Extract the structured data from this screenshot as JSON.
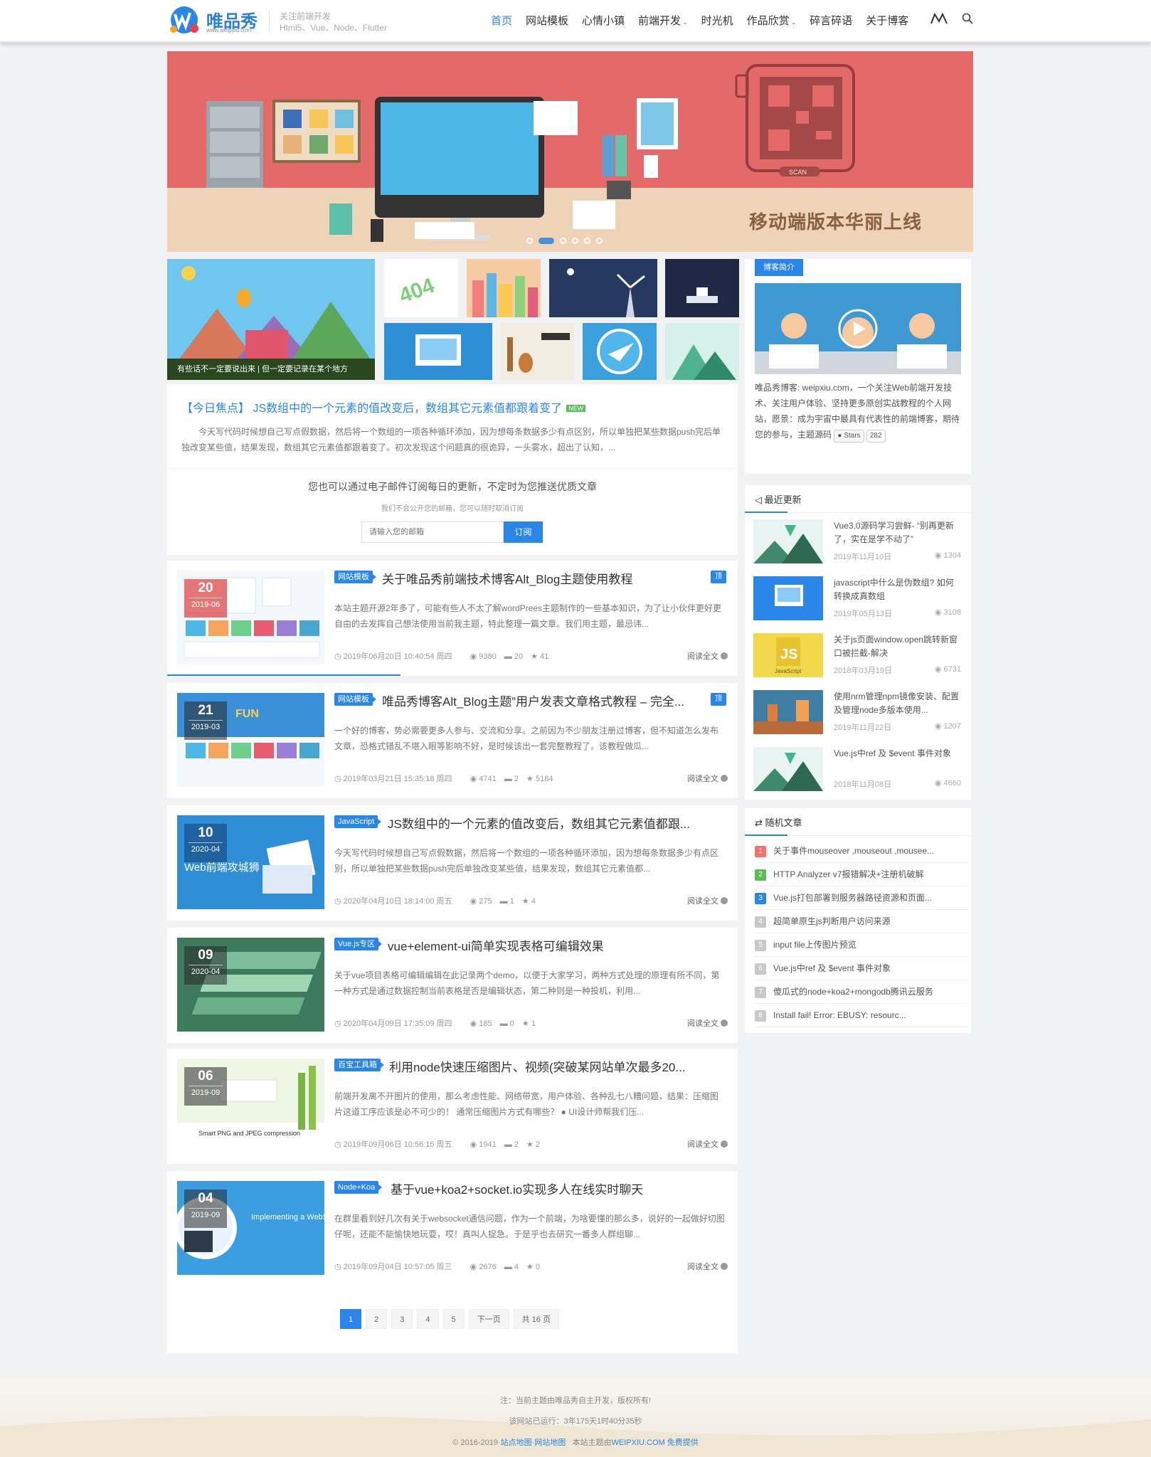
{
  "header": {
    "brand": "唯品秀",
    "domain": "www.weipxiu.com",
    "tagline1": "关注前端开发",
    "tagline2": "Html5、Vue、Node、Flutter",
    "nav": [
      {
        "label": "首页",
        "active": true
      },
      {
        "label": "网站模板"
      },
      {
        "label": "心情小镇"
      },
      {
        "label": "前端开发",
        "dropdown": true
      },
      {
        "label": "时光机"
      },
      {
        "label": "作品欣赏",
        "dropdown": true
      },
      {
        "label": "碎言碎语"
      },
      {
        "label": "关于博客"
      }
    ],
    "icons": [
      "logo-mark-icon",
      "search-icon"
    ]
  },
  "banner": {
    "text": "移动端版本华丽上线",
    "qr_label": "SCAN",
    "bg_color": "#e46a69",
    "slides": 6,
    "active_slide": 2
  },
  "gallery": {
    "caption": "有些话不一定要说出来 | 但一定要记录在某个地方"
  },
  "focus": {
    "title": "【今日焦点】 JS数组中的一个元素的值改变后，数组其它元素值都跟着变了",
    "new_badge": "NEW",
    "excerpt": "今天写代码时候想自己写点假数据，然后将一个数组的一项各种循环添加，因为想每条数据多少有点区别，所以单独把某些数据push完后单独改变某些值，结果发现，数组其它元素值都跟着变了。初次发现这个问题真的很诡异，一头雾水，超出了认知，..."
  },
  "subscribe": {
    "title": "您也可以通过电子邮件订阅每日的更新，不定时为您推送优质文章",
    "sub": "我们不会公开您的邮箱，您可以随时取消订阅",
    "placeholder": "请输入您的邮箱",
    "button": "订阅"
  },
  "posts": [
    {
      "day": "20",
      "month": "2019-06",
      "category": "网站模板",
      "title": "关于唯品秀前端技术博客Alt_Blog主题使用教程",
      "top_label": "顶",
      "excerpt": "本站主题开源2年多了，可能有些人不太了解wordPrees主题制作的一些基本知识，为了让小伙伴更好更自由的去发挥自己想法使用当前我主题，特此整理一篇文章。我们用主题，最忌讳...",
      "date": "2019年06月20日 10:40:54 周四",
      "views": "9380",
      "comments": "20",
      "likes": "41",
      "read": "阅读全文"
    },
    {
      "day": "21",
      "month": "2019-03",
      "category": "网站模板",
      "title": "唯品秀博客Alt_Blog主题”用户发表文章格式教程 – 完全...",
      "top_label": "顶",
      "excerpt": "一个好的博客，势必需要更多人参与、交流和分享。之前因为不少朋友注册过博客，但不知道怎么发布文章，恐格式错乱不堪入眼等影响不好，是时候该出一套完整教程了。该教程做瓜...",
      "date": "2019年03月21日 15:35:18 周四",
      "views": "4741",
      "comments": "2",
      "likes": "5184",
      "read": "阅读全文"
    },
    {
      "day": "10",
      "month": "2020-04",
      "category": "JavaScript",
      "title": "JS数组中的一个元素的值改变后，数组其它元素值都跟...",
      "excerpt": "今天写代码时候想自己写点假数据，然后将一个数组的一项各种循环添加，因为想每条数据多少有点区别，所以单独把某些数据push完后单独改变某些值，结果发现，数组其它元素值都...",
      "date": "2020年04月10日 18:14:00 周五",
      "views": "275",
      "comments": "1",
      "likes": "4",
      "read": "阅读全文"
    },
    {
      "day": "09",
      "month": "2020-04",
      "category": "Vue.js专区",
      "title": "vue+element-ui简单实现表格可编辑效果",
      "excerpt": "关于vue项目表格可编辑编辑在此记录两个demo，以便于大家学习，两种方式处理的原理有所不同，第一种方式是通过数据控制当前表格是否是编辑状态，第二种则是一种投机，利用...",
      "date": "2020年04月09日 17:35:09 周四",
      "views": "185",
      "comments": "0",
      "likes": "1",
      "read": "阅读全文"
    },
    {
      "day": "06",
      "month": "2019-09",
      "category": "百宝工具箱",
      "title": "利用node快速压缩图片、视频(突破某网站单次最多20...",
      "excerpt": "前端开发离不开图片的使用，那么考虑性能、网络带宽，用户体验、各种乱七八糟问题，结果：压缩图片这道工序应该是必不可少的！ 通常压缩图片方式有哪些？ ● UI设计师帮我们压...",
      "date": "2019年09月06日 10:56:15 周五",
      "views": "1941",
      "comments": "2",
      "likes": "2",
      "read": "阅读全文"
    },
    {
      "day": "04",
      "month": "2019-09",
      "category": "Node+Koa",
      "title": "基于vue+koa2+socket.io实现多人在线实时聊天",
      "excerpt": "在群里看到好几次有关于websocket通信问题，作为一个前端，为啥要懂的那么多，说好的一起做好切图仔呢，还能不能愉快地玩耍，哎！真叫人捉急。于是乎也去研究一番多人群组聊...",
      "date": "2019年09月04日 10:57:05 周三",
      "views": "2676",
      "comments": "4",
      "likes": "0",
      "read": "阅读全文"
    }
  ],
  "thumb_text": {
    "fun": "FUN",
    "web_attack": "Web前端攻城狮",
    "smart_png": "Smart PNG and JPEG compression",
    "websocket": "Implementing a WebSocket Server with Node.js"
  },
  "pagination": {
    "pages": [
      "1",
      "2",
      "3",
      "4",
      "5"
    ],
    "next": "下一页",
    "total": "共 16 页",
    "active": "1"
  },
  "sidebar": {
    "about": {
      "label": "博客简介",
      "text": "唯品秀博客: weipxiu.com，一个关注Web前端开发技术、关注用户体验、坚持更多原创实战教程的个人网站，愿景：成为宇宙中最具有代表性的前端博客，期待您的参与，主题源码",
      "stars_label": "Stars",
      "stars": "282"
    },
    "recent": {
      "title": "最近更新",
      "items": [
        {
          "title": "Vue3.0源码学习尝鲜- “别再更新了，实在是学不动了”",
          "date": "2019年11月10日",
          "views": "1304"
        },
        {
          "title": "javascript中什么是伪数组? 如何转换成真数组",
          "date": "2019年05月13日",
          "views": "3108"
        },
        {
          "title": "关于js页面window.open跳转新窗口被拦截-解决",
          "date": "2018年03月19日",
          "views": "6731"
        },
        {
          "title": "使用nrm管理npm镜像安装、配置及管理node多版本使用...",
          "date": "2019年11月22日",
          "views": "1207"
        },
        {
          "title": "Vue.js中ref 及 $event 事件对象",
          "date": "2018年11月08日",
          "views": "4660"
        }
      ],
      "js_label": "JS",
      "js_caption": "JavaScript"
    },
    "random": {
      "title": "随机文章",
      "items": [
        {
          "num": "1",
          "title": "关于事件mouseover ,mouseout ,mousee...",
          "color": "#f5726c"
        },
        {
          "num": "2",
          "title": "HTTP Analyzer v7报错解决+注册机破解",
          "color": "#5bbd58"
        },
        {
          "num": "3",
          "title": "Vue.js打包部署到服务器路径资源和页面...",
          "color": "#2a86e8"
        },
        {
          "num": "4",
          "title": "超简单原生js判断用户访问来源",
          "color": "#c8c8c8"
        },
        {
          "num": "5",
          "title": "input file上传图片预览",
          "color": "#c8c8c8"
        },
        {
          "num": "6",
          "title": "Vue.js中ref 及 $event 事件对象",
          "color": "#c8c8c8"
        },
        {
          "num": "7",
          "title": "傻瓜式的node+koa2+mongodb腾讯云服务",
          "color": "#c8c8c8"
        },
        {
          "num": "8",
          "title": "Install fail! Error: EBUSY: resourc...",
          "color": "#c8c8c8"
        }
      ]
    }
  },
  "footer": {
    "line1": "注：当前主题由唯品秀自主开发，版权所有!",
    "line2": "该网站已运行：3年175天1时40分35秒",
    "line3_prefix": "© 2016-2019·",
    "sitemap1": "站点地图",
    "dot": "·",
    "sitemap2": "网站地图",
    "theme_by": "本站主题由",
    "theme_link": "WEIPXIU.COM",
    "provided": "免费提供"
  },
  "colors": {
    "accent": "#2a86e8",
    "banner": "#e46a69"
  }
}
